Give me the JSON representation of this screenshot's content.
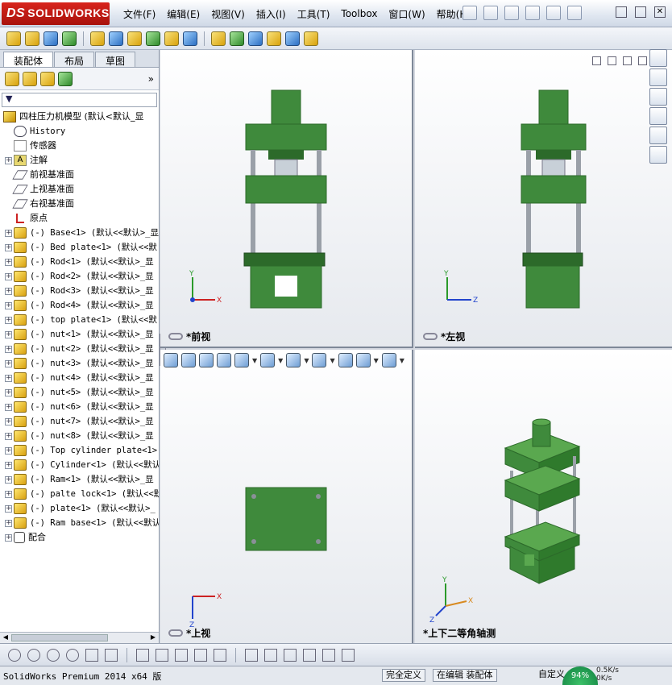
{
  "app": {
    "logo_ds": "DS",
    "logo_text": "SOLIDWORKS"
  },
  "menu": [
    "文件(F)",
    "编辑(E)",
    "视图(V)",
    "插入(I)",
    "工具(T)",
    "Toolbox",
    "窗口(W)",
    "帮助(H)"
  ],
  "panel_tabs": [
    "装配体",
    "布局",
    "草图"
  ],
  "filter": {
    "label": "▼"
  },
  "tree": {
    "root": "四柱压力机模型  (默认<默认_显",
    "items": [
      {
        "type": "hist",
        "label": "History"
      },
      {
        "type": "sensor",
        "label": "传感器"
      },
      {
        "type": "note",
        "label": "注解"
      },
      {
        "type": "plane",
        "label": "前视基准面"
      },
      {
        "type": "plane",
        "label": "上视基准面"
      },
      {
        "type": "plane",
        "label": "右视基准面"
      },
      {
        "type": "origin",
        "label": "原点"
      },
      {
        "type": "part",
        "label": "(-) Base<1> (默认<<默认>_显"
      },
      {
        "type": "part",
        "label": "(-) Bed plate<1> (默认<<默"
      },
      {
        "type": "part",
        "label": "(-) Rod<1> (默认<<默认>_显"
      },
      {
        "type": "part",
        "label": "(-) Rod<2> (默认<<默认>_显"
      },
      {
        "type": "part",
        "label": "(-) Rod<3> (默认<<默认>_显"
      },
      {
        "type": "part",
        "label": "(-) Rod<4> (默认<<默认>_显"
      },
      {
        "type": "part",
        "label": "(-) top plate<1> (默认<<默"
      },
      {
        "type": "part",
        "label": "(-) nut<1> (默认<<默认>_显"
      },
      {
        "type": "part",
        "label": "(-) nut<2> (默认<<默认>_显"
      },
      {
        "type": "part",
        "label": "(-) nut<3> (默认<<默认>_显"
      },
      {
        "type": "part",
        "label": "(-) nut<4> (默认<<默认>_显"
      },
      {
        "type": "part",
        "label": "(-) nut<5> (默认<<默认>_显"
      },
      {
        "type": "part",
        "label": "(-) nut<6> (默认<<默认>_显"
      },
      {
        "type": "part",
        "label": "(-) nut<7> (默认<<默认>_显"
      },
      {
        "type": "part",
        "label": "(-) nut<8> (默认<<默认>_显"
      },
      {
        "type": "part",
        "label": "(-) Top cylinder plate<1>"
      },
      {
        "type": "part",
        "label": "(-) Cylinder<1> (默认<<默认"
      },
      {
        "type": "part",
        "label": "(-) Ram<1> (默认<<默认>_显"
      },
      {
        "type": "part",
        "label": "(-) palte lock<1> (默认<<默"
      },
      {
        "type": "part",
        "label": "(-) plate<1> (默认<<默认>_"
      },
      {
        "type": "part",
        "label": "(-) Ram base<1> (默认<<默认"
      },
      {
        "type": "mate",
        "label": "配合"
      }
    ]
  },
  "viewports": {
    "front": "*前视",
    "left": "*左视",
    "top": "*上视",
    "iso": "*上下二等角轴测"
  },
  "axes": {
    "x": "X",
    "y": "Y",
    "z": "Z"
  },
  "colors": {
    "model_green": "#3f8a3c",
    "model_dark": "#2c6a2a",
    "rod": "#9aa0a8"
  },
  "status": {
    "product": "SolidWorks Premium 2014 x64 版",
    "definition": "完全定义",
    "editing": "在编辑 装配体",
    "custom": "自定义",
    "percent": "94%",
    "speed_up": "0.5K/s",
    "speed_down": "0K/s"
  }
}
